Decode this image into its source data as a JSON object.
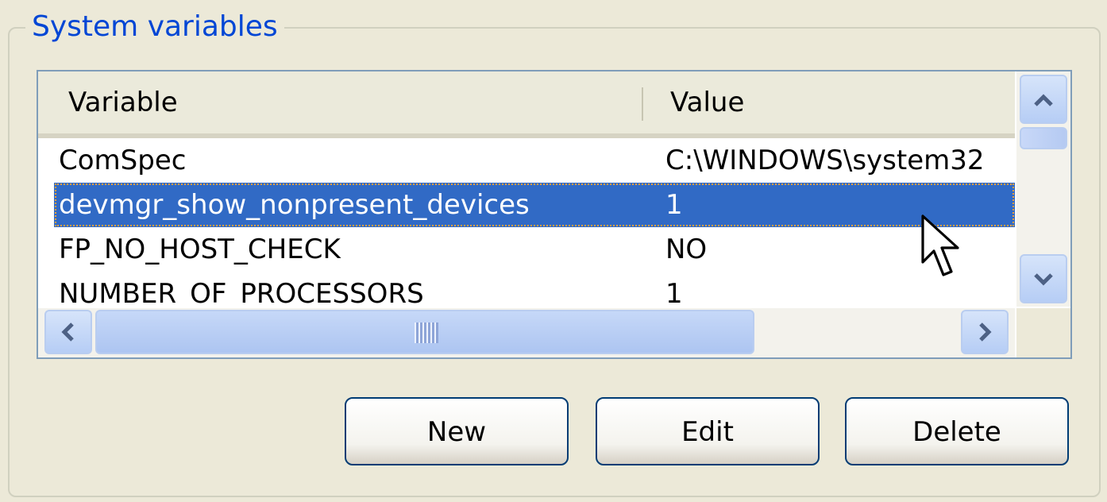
{
  "group": {
    "title": "System variables"
  },
  "list": {
    "columns": {
      "variable": "Variable",
      "value": "Value"
    },
    "rows": [
      {
        "variable": "ComSpec",
        "value": "C:\\WINDOWS\\system32",
        "selected": false
      },
      {
        "variable": "devmgr_show_nonpresent_devices",
        "value": "1",
        "selected": true
      },
      {
        "variable": "FP_NO_HOST_CHECK",
        "value": "NO",
        "selected": false
      },
      {
        "variable": "NUMBER_OF_PROCESSORS",
        "value": "1",
        "selected": false
      }
    ]
  },
  "icons": {
    "scroll_up": "chevron-up-icon",
    "scroll_down": "chevron-down-icon",
    "scroll_left": "chevron-left-icon",
    "scroll_right": "chevron-right-icon",
    "cursor": "mouse-pointer-icon"
  },
  "buttons": {
    "new": "New",
    "edit": "Edit",
    "delete": "Delete"
  },
  "colors": {
    "title": "#0046D5",
    "selection": "#316AC5",
    "background": "#ECE9D8",
    "button_border": "#003C74"
  }
}
